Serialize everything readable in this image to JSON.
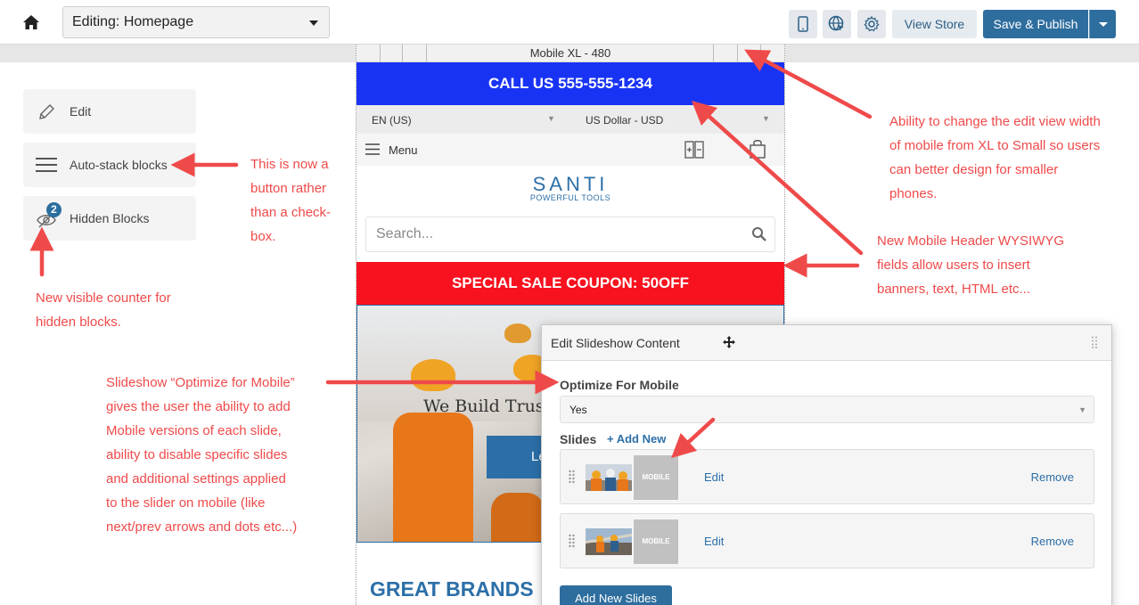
{
  "topbar": {
    "page_select_value": "Editing: Homepage",
    "view_store_label": "View Store",
    "save_publish_label": "Save & Publish"
  },
  "left_panel": {
    "edit_label": "Edit",
    "autostack_label": "Auto-stack blocks",
    "hidden_label": "Hidden Blocks",
    "hidden_count": "2"
  },
  "preview": {
    "ruler_label": "Mobile XL - 480",
    "call_bar": "CALL US 555-555-1234",
    "language": "EN (US)",
    "currency": "US Dollar - USD",
    "menu_label": "Menu",
    "logo_brand": "SANTI",
    "logo_tagline": "POWERFUL TOOLS",
    "search_placeholder": "Search...",
    "sale_bar": "SPECIAL SALE COUPON: 50OFF",
    "slide_headline": "We Build Trust,",
    "slide_button": "Le",
    "brands_heading": "GREAT BRANDS"
  },
  "modal": {
    "title": "Edit Slideshow Content",
    "optimize_label": "Optimize For Mobile",
    "optimize_value": "Yes",
    "slides_label": "Slides",
    "add_new_label": "+ Add New",
    "slides": [
      {
        "mobile_label": "MOBILE",
        "edit": "Edit",
        "remove": "Remove"
      },
      {
        "mobile_label": "MOBILE",
        "edit": "Edit",
        "remove": "Remove"
      }
    ],
    "add_slides_button": "Add New Slides"
  },
  "annotations": {
    "button": [
      "This is now a",
      "button rather",
      "than a check-",
      "box."
    ],
    "counter": [
      "New visible counter for",
      "hidden blocks."
    ],
    "slideshow": [
      "Slideshow “Optimize for Mobile”",
      "gives the user the ability to add",
      "Mobile versions of each slide,",
      "ability to disable specific slides",
      "and additional settings applied",
      "to the slider on mobile (like",
      "next/prev arrows and dots etc...)"
    ],
    "width": [
      "Ability to change the edit view width",
      "of mobile from XL to Small so users",
      "can better design for smaller",
      "phones."
    ],
    "header": [
      "New Mobile Header WYSIWYG",
      "fields allow users to insert",
      "banners, text, HTML etc..."
    ]
  },
  "colors": {
    "accent": "#2e6e9e",
    "annotation": "#ef4a4a",
    "call_bar": "#1933f5",
    "sale_bar": "#f8111e"
  },
  "icons": [
    "home-icon",
    "mobile-device-icon",
    "globe-cursor-icon",
    "gear-icon",
    "pencil-icon",
    "hamburger-icon",
    "eye-slash-icon",
    "compare-icon",
    "shopping-bag-icon",
    "search-icon",
    "move-icon",
    "grip-icon",
    "drag-handle-icon"
  ]
}
